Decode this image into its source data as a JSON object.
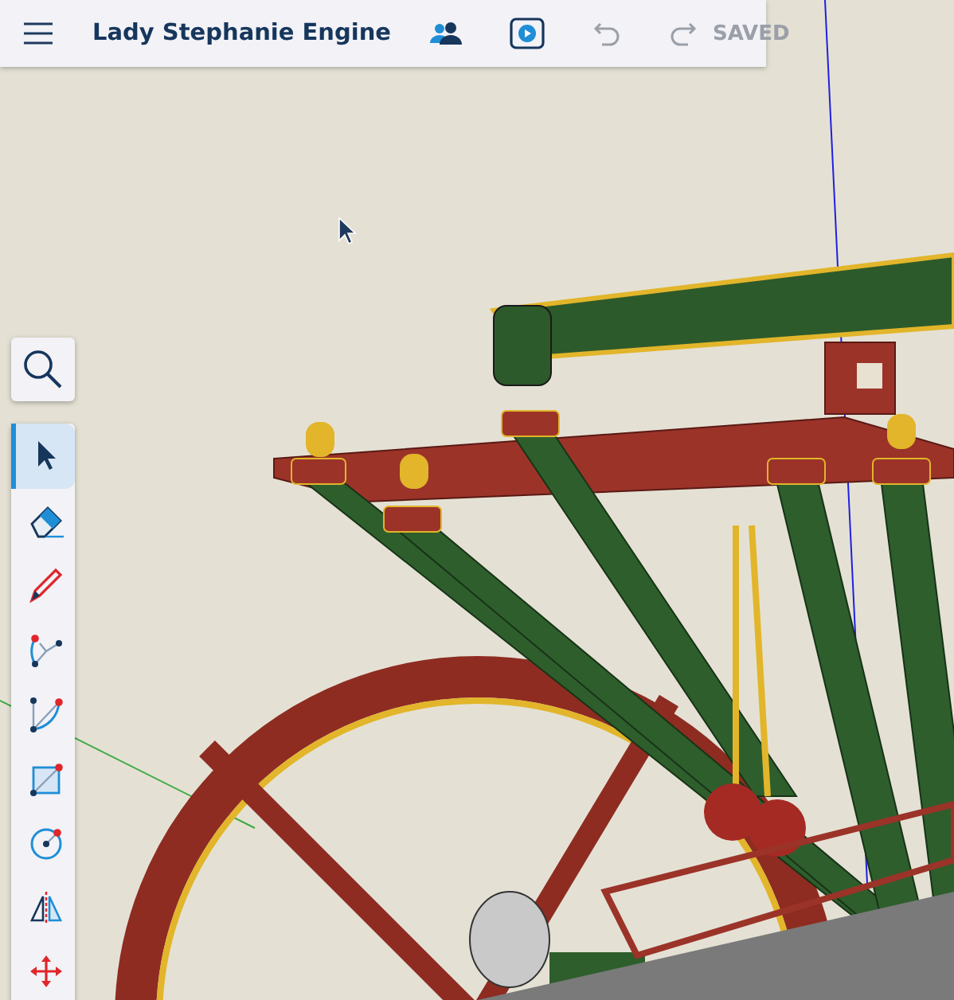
{
  "header": {
    "title": "Lady Stephanie Engine",
    "undo_disabled": true,
    "redo_disabled": true,
    "status": "SAVED"
  },
  "tools": [
    {
      "kind": "select",
      "selected": true
    },
    {
      "kind": "eraser",
      "selected": false
    },
    {
      "kind": "pencil",
      "selected": false
    },
    {
      "kind": "arc",
      "selected": false
    },
    {
      "kind": "arc2",
      "selected": false
    },
    {
      "kind": "rectangle",
      "selected": false
    },
    {
      "kind": "circle",
      "selected": false
    },
    {
      "kind": "flip",
      "selected": false
    },
    {
      "kind": "move",
      "selected": false
    }
  ]
}
